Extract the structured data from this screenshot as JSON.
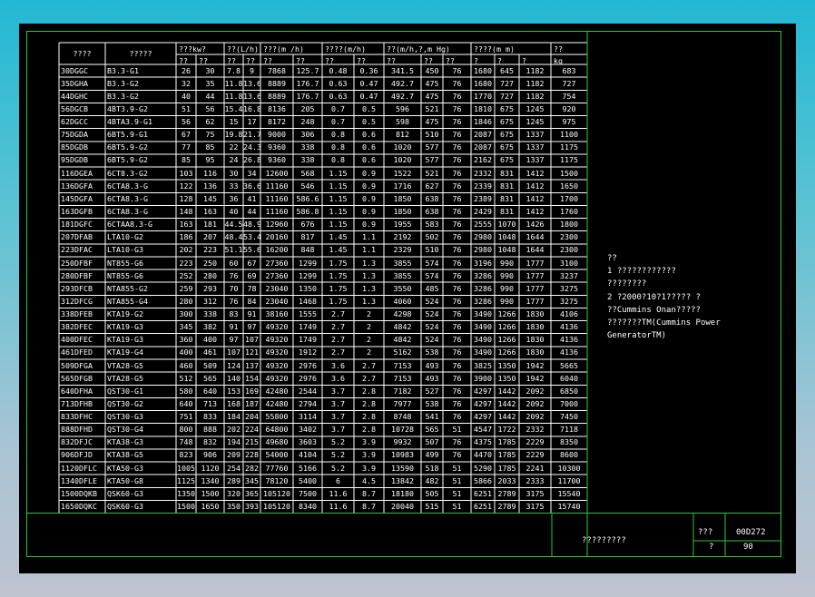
{
  "table": {
    "header": {
      "model": "????",
      "engine": "?????",
      "power_group": "???kw?",
      "fuel_group": "??(L/h)",
      "air_group": "???(m /h)",
      "exhaust_group": "????(m/h)",
      "backpressure_group": "??(m/h,?,m Hg)",
      "dims_group": "????(m m)",
      "weight_group": "??",
      "sub": [
        "??",
        "??",
        "??",
        "??",
        "??",
        "??",
        "??",
        "??",
        "??",
        "??",
        "??",
        "?",
        "?",
        "?",
        "kg"
      ]
    },
    "rows": [
      [
        "30DGGC",
        "B3.3-G1",
        "26",
        "30",
        "7.8",
        "9",
        "7868",
        "125.7",
        "0.48",
        "0.36",
        "341.5",
        "450",
        "76",
        "1680",
        "645",
        "1182",
        "683"
      ],
      [
        "35DGHA",
        "B3.3-G2",
        "32",
        "35",
        "11.8",
        "13.6",
        "8889",
        "176.7",
        "0.63",
        "0.47",
        "492.7",
        "475",
        "76",
        "1680",
        "727",
        "1182",
        "727"
      ],
      [
        "44DGHC",
        "B3.3-G2",
        "40",
        "44",
        "11.8",
        "13.6",
        "8889",
        "176.7",
        "0.63",
        "0.47",
        "492.7",
        "475",
        "76",
        "1770",
        "727",
        "1182",
        "754"
      ],
      [
        "56DGCB",
        "4BT3.9-G2",
        "51",
        "56",
        "15.4",
        "16.8",
        "8136",
        "205",
        "0.7",
        "0.5",
        "596",
        "521",
        "76",
        "1810",
        "675",
        "1245",
        "920"
      ],
      [
        "62DGCC",
        "4BTA3.9-G1",
        "56",
        "62",
        "15",
        "17",
        "8172",
        "248",
        "0.7",
        "0.5",
        "598",
        "475",
        "76",
        "1846",
        "675",
        "1245",
        "975"
      ],
      [
        "75DGDA",
        "6BT5.9-G1",
        "67",
        "75",
        "19.8",
        "21.7",
        "9000",
        "306",
        "0.8",
        "0.6",
        "812",
        "510",
        "76",
        "2087",
        "675",
        "1337",
        "1100"
      ],
      [
        "85DGDB",
        "6BT5.9-G2",
        "77",
        "85",
        "22",
        "24.3",
        "9360",
        "338",
        "0.8",
        "0.6",
        "1020",
        "577",
        "76",
        "2087",
        "675",
        "1337",
        "1175"
      ],
      [
        "95DGDB",
        "6BT5.9-G2",
        "85",
        "95",
        "24",
        "26.8",
        "9360",
        "338",
        "0.8",
        "0.6",
        "1020",
        "577",
        "76",
        "2162",
        "675",
        "1337",
        "1175"
      ],
      [
        "116DGEA",
        "6CT8.3-G2",
        "103",
        "116",
        "30",
        "34",
        "12600",
        "568",
        "1.15",
        "0.9",
        "1522",
        "521",
        "76",
        "2332",
        "831",
        "1412",
        "1500"
      ],
      [
        "136DGFA",
        "6CTA8.3-G",
        "122",
        "136",
        "33",
        "36.6",
        "11160",
        "546",
        "1.15",
        "0.9",
        "1716",
        "627",
        "76",
        "2339",
        "831",
        "1412",
        "1650"
      ],
      [
        "145DGFA",
        "6CTA8.3-G",
        "128",
        "145",
        "36",
        "41",
        "11160",
        "586.6",
        "1.15",
        "0.9",
        "1850",
        "638",
        "76",
        "2389",
        "831",
        "1412",
        "1700"
      ],
      [
        "163DGFB",
        "6CTA8.3-G",
        "148",
        "163",
        "40",
        "44",
        "11160",
        "586.8",
        "1.15",
        "0.9",
        "1850",
        "638",
        "76",
        "2429",
        "831",
        "1412",
        "1760"
      ],
      [
        "181DGFC",
        "6CTAA8.3-G",
        "163",
        "181",
        "44.5",
        "48.9",
        "12960",
        "676",
        "1.15",
        "0.9",
        "1955",
        "583",
        "76",
        "2555",
        "1070",
        "1426",
        "1800"
      ],
      [
        "207DFAB",
        "LTA10-G2",
        "186",
        "207",
        "48.4",
        "53.4",
        "20160",
        "817",
        "1.45",
        "1.1",
        "2192",
        "502",
        "76",
        "2980",
        "1048",
        "1644",
        "2300"
      ],
      [
        "223DFAC",
        "LTA10-G3",
        "202",
        "223",
        "51.1",
        "55.6",
        "16200",
        "848",
        "1.45",
        "1.1",
        "2329",
        "510",
        "76",
        "2980",
        "1048",
        "1644",
        "2300"
      ],
      [
        "250DFBF",
        "NT855-G6",
        "223",
        "250",
        "60",
        "67",
        "27360",
        "1299",
        "1.75",
        "1.3",
        "3855",
        "574",
        "76",
        "3196",
        "990",
        "1777",
        "3100"
      ],
      [
        "280DFBF",
        "NT855-G6",
        "252",
        "280",
        "76",
        "69",
        "27360",
        "1299",
        "1.75",
        "1.3",
        "3855",
        "574",
        "76",
        "3286",
        "990",
        "1777",
        "3237"
      ],
      [
        "293DFCB",
        "NTA855-G2",
        "259",
        "293",
        "70",
        "78",
        "23040",
        "1350",
        "1.75",
        "1.3",
        "3550",
        "485",
        "76",
        "3286",
        "990",
        "1777",
        "3275"
      ],
      [
        "312DFCG",
        "NTA855-G4",
        "280",
        "312",
        "76",
        "84",
        "23040",
        "1468",
        "1.75",
        "1.3",
        "4060",
        "524",
        "76",
        "3286",
        "990",
        "1777",
        "3275"
      ],
      [
        "338DFEB",
        "KTA19-G2",
        "300",
        "338",
        "83",
        "91",
        "38160",
        "1555",
        "2.7",
        "2",
        "4298",
        "524",
        "76",
        "3490",
        "1266",
        "1830",
        "4106"
      ],
      [
        "382DFEC",
        "KTA19-G3",
        "345",
        "382",
        "91",
        "97",
        "49320",
        "1749",
        "2.7",
        "2",
        "4842",
        "524",
        "76",
        "3490",
        "1266",
        "1830",
        "4136"
      ],
      [
        "400DFEC",
        "KTA19-G3",
        "360",
        "400",
        "97",
        "107",
        "49320",
        "1749",
        "2.7",
        "2",
        "4842",
        "524",
        "76",
        "3490",
        "1266",
        "1830",
        "4136"
      ],
      [
        "461DFED",
        "KTA19-G4",
        "400",
        "461",
        "107",
        "121",
        "49320",
        "1912",
        "2.7",
        "2",
        "5162",
        "538",
        "76",
        "3490",
        "1266",
        "1830",
        "4136"
      ],
      [
        "509DFGA",
        "VTA28-G5",
        "460",
        "509",
        "124",
        "137",
        "49320",
        "2976",
        "3.6",
        "2.7",
        "7153",
        "493",
        "76",
        "3825",
        "1350",
        "1942",
        "5665"
      ],
      [
        "565DFGB",
        "VTA28-G5",
        "512",
        "565",
        "140",
        "154",
        "49320",
        "2976",
        "3.6",
        "2.7",
        "7153",
        "493",
        "76",
        "3900",
        "1350",
        "1942",
        "6040"
      ],
      [
        "640DFHA",
        "QST30-G1",
        "580",
        "640",
        "153",
        "169",
        "42480",
        "2544",
        "3.7",
        "2.8",
        "7182",
        "527",
        "76",
        "4297",
        "1442",
        "2092",
        "6850"
      ],
      [
        "713DFHB",
        "QST30-G2",
        "640",
        "713",
        "168",
        "187",
        "42480",
        "2794",
        "3.7",
        "2.8",
        "7977",
        "538",
        "76",
        "4297",
        "1442",
        "2092",
        "7000"
      ],
      [
        "833DFHC",
        "QST30-G3",
        "751",
        "833",
        "184",
        "204",
        "55800",
        "3114",
        "3.7",
        "2.8",
        "8748",
        "541",
        "76",
        "4297",
        "1442",
        "2092",
        "7450"
      ],
      [
        "888DFHD",
        "QST30-G4",
        "800",
        "888",
        "202",
        "224",
        "64800",
        "3402",
        "3.7",
        "2.8",
        "10728",
        "565",
        "51",
        "4547",
        "1722",
        "2332",
        "7118"
      ],
      [
        "832DFJC",
        "KTA38-G3",
        "748",
        "832",
        "194",
        "215",
        "49680",
        "3603",
        "5.2",
        "3.9",
        "9932",
        "507",
        "76",
        "4375",
        "1785",
        "2229",
        "8350"
      ],
      [
        "906DFJD",
        "KTA38-G5",
        "823",
        "906",
        "209",
        "228",
        "54000",
        "4104",
        "5.2",
        "3.9",
        "10983",
        "499",
        "76",
        "4470",
        "1785",
        "2229",
        "8600"
      ],
      [
        "1120DFLC",
        "KTA50-G3",
        "1005",
        "1120",
        "254",
        "282",
        "77760",
        "5166",
        "5.2",
        "3.9",
        "13590",
        "518",
        "51",
        "5290",
        "1785",
        "2241",
        "10300"
      ],
      [
        "1340DFLE",
        "KTA50-G8",
        "1125",
        "1340",
        "289",
        "345",
        "78120",
        "5400",
        "6",
        "4.5",
        "13842",
        "482",
        "51",
        "5866",
        "2033",
        "2333",
        "11700"
      ],
      [
        "1500DQKB",
        "QSK60-G3",
        "1350",
        "1500",
        "320",
        "365",
        "105120",
        "7500",
        "11.6",
        "8.7",
        "18180",
        "505",
        "51",
        "6251",
        "2789",
        "3175",
        "15540"
      ],
      [
        "1650DQKC",
        "QSK60-G3",
        "1500",
        "1650",
        "350",
        "393",
        "105120",
        "8340",
        "11.6",
        "8.7",
        "20040",
        "515",
        "51",
        "6251",
        "2789",
        "3175",
        "15740"
      ]
    ]
  },
  "notes": {
    "title": "??",
    "lines": [
      "1 ????????????",
      "  ????????",
      "2 ?2000?10?1????? ?",
      "  ??Cummins Onan?????",
      "  ???????TM(Cummins Power",
      "  GeneratorTM)"
    ]
  },
  "title_block": {
    "drawing_name": "?????????",
    "label_code": "???",
    "code": "00D272",
    "label_page": "?",
    "page": "90"
  },
  "colors": {
    "sheet_bg": "#000000",
    "frame_line": "#2fc73b",
    "table_line": "#ffffff",
    "text": "#ffffff"
  }
}
